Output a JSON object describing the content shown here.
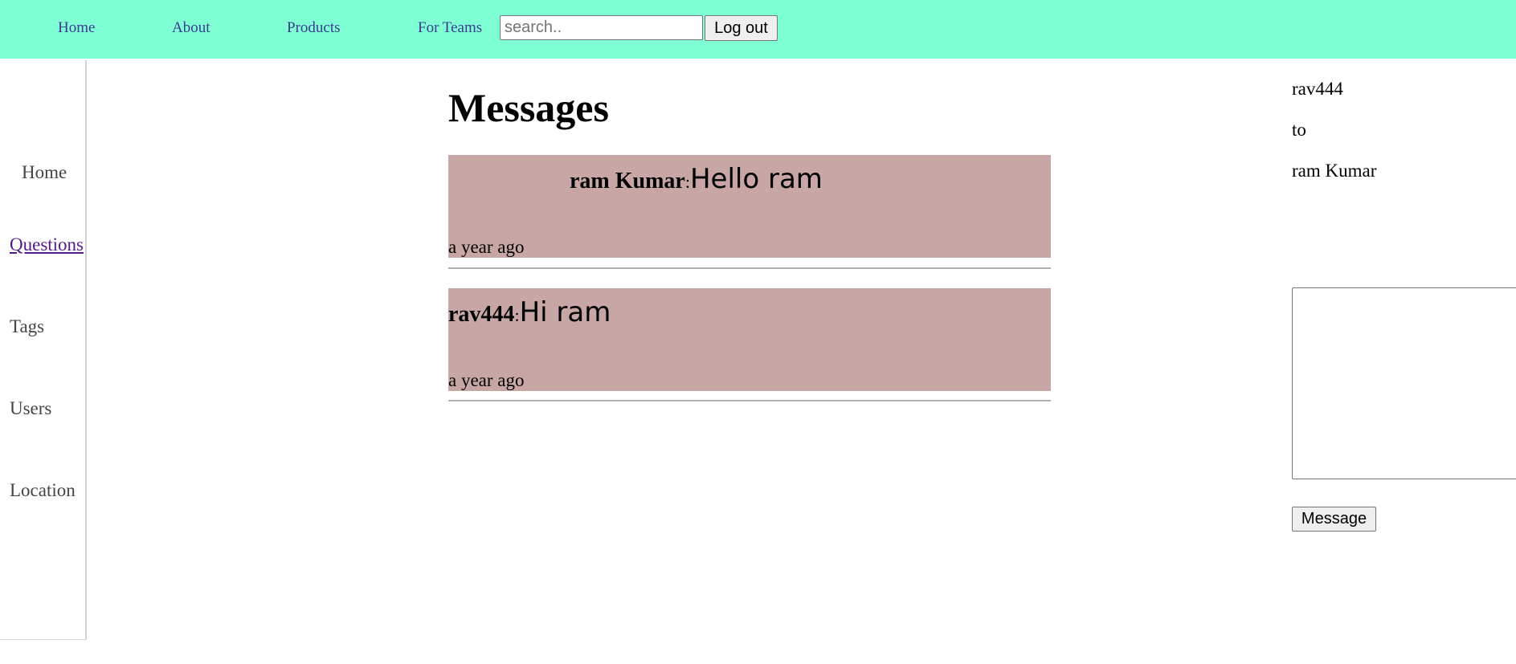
{
  "header": {
    "nav": [
      {
        "label": "Home"
      },
      {
        "label": "About"
      },
      {
        "label": "Products"
      },
      {
        "label": "For Teams"
      }
    ],
    "search": {
      "placeholder": "search..",
      "value": ""
    },
    "logout_label": "Log out"
  },
  "sidebar": {
    "items": [
      {
        "label": "Home"
      },
      {
        "label": "Questions"
      },
      {
        "label": "Tags"
      },
      {
        "label": "Users"
      },
      {
        "label": "Location"
      }
    ],
    "active": "Questions"
  },
  "main": {
    "title": "Messages",
    "messages": [
      {
        "sender": "ram Kumar",
        "separator": ":",
        "text": "Hello ram",
        "time": "a year ago"
      },
      {
        "sender": "rav444",
        "separator": ":",
        "text": "Hi ram",
        "time": "a year ago"
      }
    ]
  },
  "compose": {
    "from": "rav444",
    "to_label": "to",
    "recipient": "ram Kumar",
    "message_value": "",
    "button_label": "Message"
  },
  "colors": {
    "header_bg": "#7fffd4",
    "message_bg": "#c8a6a6",
    "link_visited": "#551a8b"
  }
}
